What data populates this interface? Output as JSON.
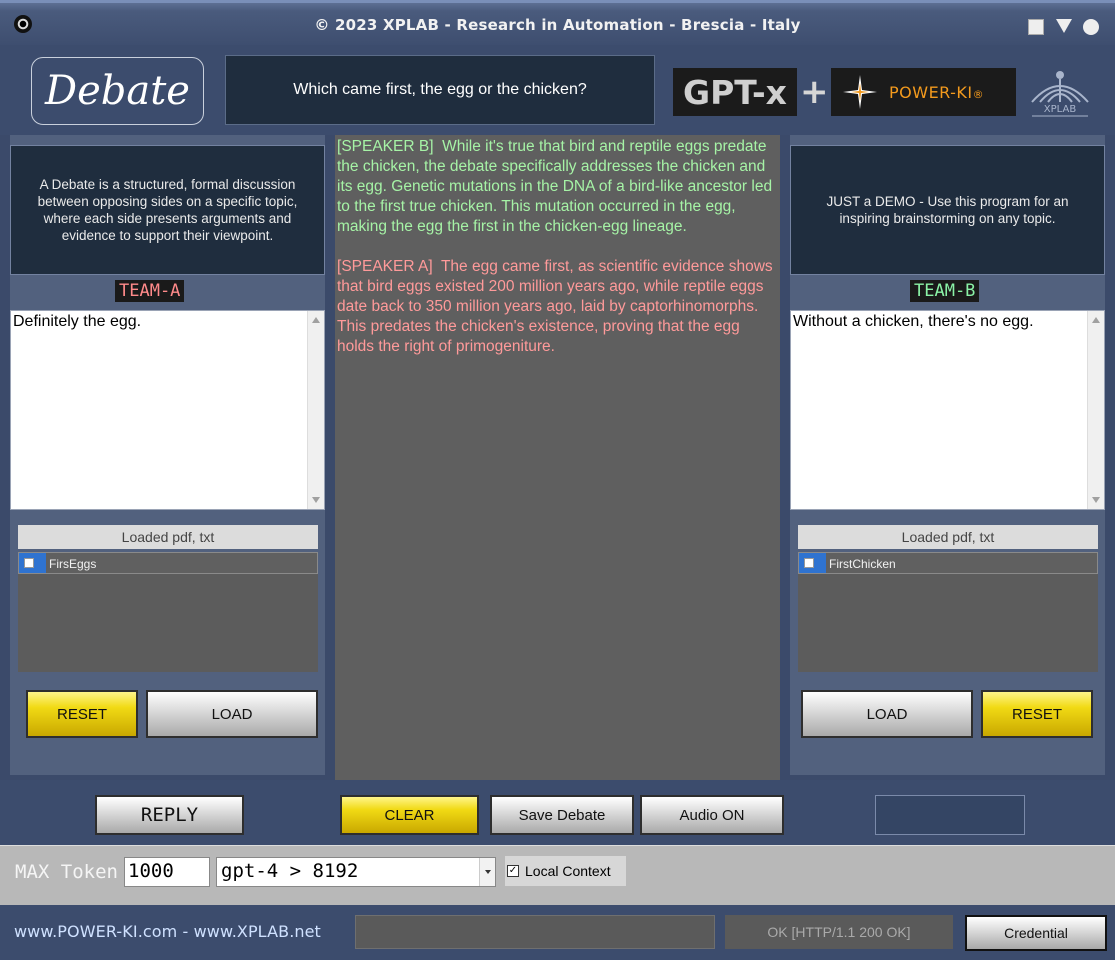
{
  "window": {
    "title": "© 2023 XPLAB - Research in Automation - Brescia - Italy"
  },
  "header": {
    "logo_text": "Debate",
    "question": "Which came first, the egg or the chicken?",
    "brand_gpt": "GPT-x",
    "brand_plus": "+",
    "brand_powerki": "POWER-KI",
    "brand_powerki_reg": "®"
  },
  "left_panel": {
    "info": "A Debate is a structured, formal discussion between opposing sides on a specific topic, where each side presents arguments and evidence to support their viewpoint.",
    "team_label": "TEAM-A",
    "team_color": "#ff8a8a",
    "position_text": "Definitely the egg.",
    "files_header": "Loaded pdf, txt",
    "files": [
      {
        "name": "FirsEggs",
        "checked": false
      }
    ],
    "reset_label": "RESET",
    "load_label": "LOAD"
  },
  "right_panel": {
    "info": "JUST a DEMO - Use this program for an inspiring brainstorming on any topic.",
    "team_label": "TEAM-B",
    "team_color": "#8af2a6",
    "position_text": "Without a chicken, there's no egg.",
    "files_header": "Loaded pdf, txt",
    "files": [
      {
        "name": "FirstChicken",
        "checked": false
      }
    ],
    "load_label": "LOAD",
    "reset_label": "RESET"
  },
  "debate": {
    "entries": [
      {
        "speaker": "SPEAKER B",
        "color": "#a6f3a6",
        "text": "While it's true that bird and reptile eggs predate the chicken, the debate specifically addresses the chicken and its egg. Genetic mutations in the DNA of a bird-like ancestor led to the first true chicken. This mutation occurred in the egg, making the egg the first in the chicken-egg lineage."
      },
      {
        "speaker": "SPEAKER A",
        "color": "#ff9a9a",
        "text": "The egg came first, as scientific evidence shows that bird eggs existed 200 million years ago, while reptile eggs date back to 350 million years ago, laid by captorhinomorphs. This predates the chicken's existence, proving that the egg holds the right of primogeniture."
      }
    ]
  },
  "toolbar": {
    "reply_label": "REPLY",
    "clear_label": "CLEAR",
    "save_label": "Save Debate",
    "audio_label": "Audio ON"
  },
  "settings": {
    "max_token_label": "MAX Token",
    "max_token_value": "1000",
    "model_value": "gpt-4 > 8192",
    "local_context_label": "Local Context",
    "local_context_checked": true
  },
  "footer": {
    "links": "www.POWER-KI.com  -  www.XPLAB.net",
    "status": "OK [HTTP/1.1 200 OK]",
    "credential_label": "Credential"
  }
}
